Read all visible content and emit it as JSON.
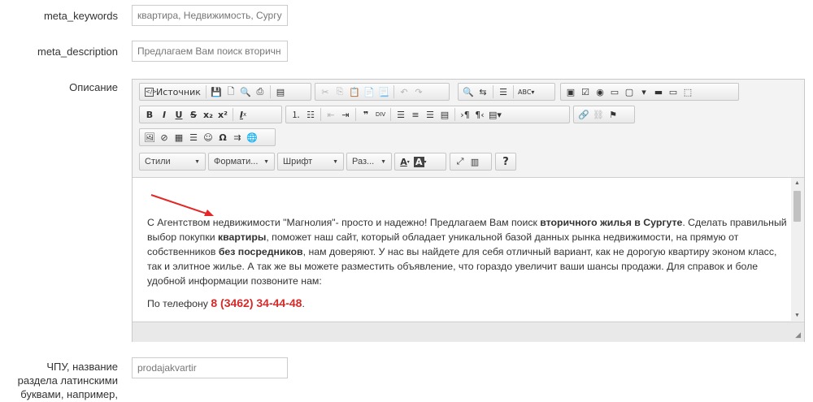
{
  "fields": {
    "meta_keywords": {
      "label": "meta_keywords",
      "value": "квартира, Недвижимость, Сургу"
    },
    "meta_description": {
      "label": "meta_description",
      "value": "Предлагаем Вам поиск вторичн"
    },
    "opisanie": {
      "label": "Описание"
    },
    "chpu": {
      "label_lines": [
        "ЧПУ, название",
        "раздела латинскими",
        "буквами, например,"
      ],
      "value": "prodajakvartir"
    }
  },
  "editor": {
    "source_label": "Источник",
    "combos": {
      "styles": "Стили",
      "format": "Формати...",
      "font": "Шрифт",
      "size": "Раз..."
    },
    "help_label": "?",
    "content": {
      "p1": {
        "t1": "С Агентством недвижимости \"Магнолия\"- просто и надежно! Предлагаем Вам поиск ",
        "b1": "вторичного жилья в Сургуте",
        "t2": ". Сделать правильный выбор покупки ",
        "b2": "квартиры",
        "t3": ", поможет наш сайт, который обладает уникальной базой данных рынка недвижимости, на прямую от собственников ",
        "b3": "без посредников",
        "t4": ", нам доверяют. У нас вы найдете для себя отличный вариант, как не дорогую квартиру эконом класс, так и элитное жилье. А так же вы можете разместить объявление, что гораздо увеличит ваши шансы продажи. Для справок и боле удобной информации позвоните нам:"
      },
      "p2": {
        "t1": "По телефону ",
        "phone": "8 (3462) 34-44-48",
        "t2": "."
      }
    }
  },
  "colors": {
    "accent_red": "#d62a2a",
    "arrow_red": "#e32626"
  }
}
